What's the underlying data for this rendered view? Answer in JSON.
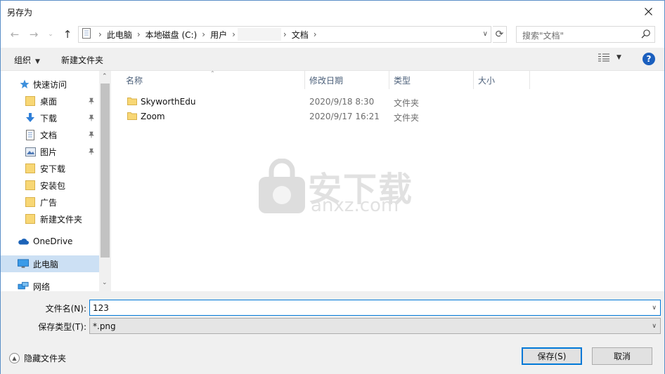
{
  "window": {
    "title": "另存为"
  },
  "nav": {
    "breadcrumbs": [
      "此电脑",
      "本地磁盘 (C:)",
      "用户",
      "文档"
    ],
    "search_placeholder": "搜索\"文档\""
  },
  "toolbar": {
    "organize_label": "组织",
    "new_folder_label": "新建文件夹"
  },
  "sidebar": {
    "quick_access": "快速访问",
    "items": [
      {
        "label": "桌面",
        "icon": "folder-desktop-icon",
        "pinned": true
      },
      {
        "label": "下载",
        "icon": "download-arrow-icon",
        "pinned": true
      },
      {
        "label": "文档",
        "icon": "document-icon",
        "pinned": true
      },
      {
        "label": "图片",
        "icon": "picture-icon",
        "pinned": true
      },
      {
        "label": "安下载",
        "icon": "folder-icon",
        "pinned": false
      },
      {
        "label": "安装包",
        "icon": "folder-icon",
        "pinned": false
      },
      {
        "label": "广告",
        "icon": "folder-icon",
        "pinned": false
      },
      {
        "label": "新建文件夹",
        "icon": "folder-icon",
        "pinned": false
      }
    ],
    "onedrive": "OneDrive",
    "this_pc": "此电脑",
    "network": "网络"
  },
  "columns": {
    "name": "名称",
    "date": "修改日期",
    "type": "类型",
    "size": "大小"
  },
  "files": [
    {
      "name": "SkyworthEdu",
      "date": "2020/9/18 8:30",
      "type": "文件夹"
    },
    {
      "name": "Zoom",
      "date": "2020/9/17 16:21",
      "type": "文件夹"
    }
  ],
  "watermark": {
    "cn": "安下载",
    "en": "anxz.com"
  },
  "form": {
    "filename_label": "文件名(N):",
    "filename_value": "123",
    "filetype_label": "保存类型(T):",
    "filetype_value": "*.png"
  },
  "footer": {
    "hide_folders_label": "隐藏文件夹",
    "save_label": "保存(S)",
    "cancel_label": "取消"
  },
  "colors": {
    "accent": "#0078d7",
    "selection": "#cce0f4",
    "help": "#1b5fbe"
  }
}
